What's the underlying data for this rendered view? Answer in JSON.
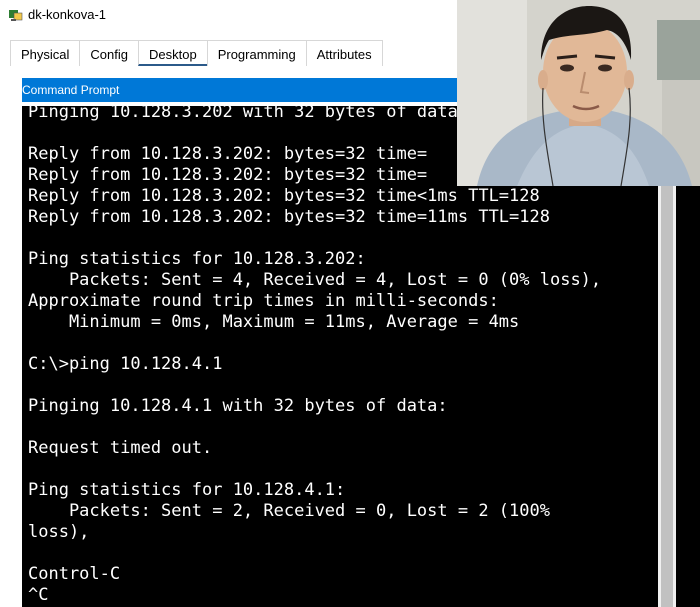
{
  "window": {
    "title": "dk-konkova-1"
  },
  "tabs": [
    {
      "label": "Physical"
    },
    {
      "label": "Config"
    },
    {
      "label": "Desktop"
    },
    {
      "label": "Programming"
    },
    {
      "label": "Attributes"
    }
  ],
  "active_tab": "Desktop",
  "command_prompt": {
    "title": "Command Prompt",
    "lines": [
      "Pinging 10.128.3.202 with 32 bytes of data:",
      "",
      "Reply from 10.128.3.202: bytes=32 time=",
      "Reply from 10.128.3.202: bytes=32 time=",
      "Reply from 10.128.3.202: bytes=32 time<1ms TTL=128",
      "Reply from 10.128.3.202: bytes=32 time=11ms TTL=128",
      "",
      "Ping statistics for 10.128.3.202:",
      "    Packets: Sent = 4, Received = 4, Lost = 0 (0% loss),",
      "Approximate round trip times in milli-seconds:",
      "    Minimum = 0ms, Maximum = 11ms, Average = 4ms",
      "",
      "C:\\>ping 10.128.4.1",
      "",
      "Pinging 10.128.4.1 with 32 bytes of data:",
      "",
      "Request timed out.",
      "",
      "Ping statistics for 10.128.4.1:",
      "    Packets: Sent = 2, Received = 0, Lost = 2 (100%",
      "loss),",
      "",
      "Control-C",
      "^C"
    ]
  },
  "icons": {
    "app": "packet-tracer-pc-icon"
  },
  "colors": {
    "header_blue": "#0078d7",
    "terminal_bg": "#000000",
    "terminal_text": "#ffffff",
    "active_tab_underline": "#2b5a8a"
  }
}
